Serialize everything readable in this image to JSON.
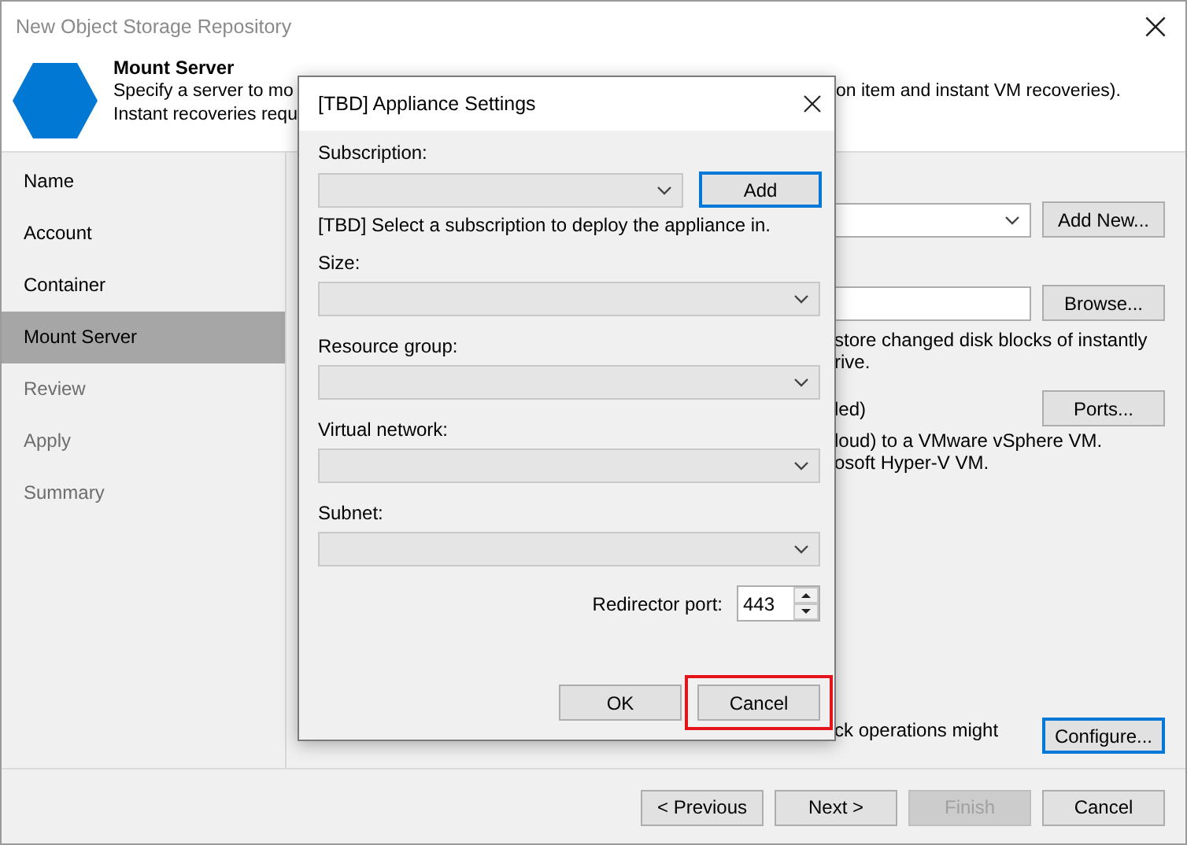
{
  "window": {
    "title": "New Object Storage Repository"
  },
  "header": {
    "title": "Mount Server",
    "line_1_start": "Specify a server to mo",
    "line_1_end": "on item and instant VM recoveries).",
    "line_2": "Instant recoveries requ"
  },
  "steps": [
    {
      "label": "Name",
      "selected": false,
      "disabled": false
    },
    {
      "label": "Account",
      "selected": false,
      "disabled": false
    },
    {
      "label": "Container",
      "selected": false,
      "disabled": false
    },
    {
      "label": "Mount Server",
      "selected": true,
      "disabled": false
    },
    {
      "label": "Review",
      "selected": false,
      "disabled": true
    },
    {
      "label": "Apply",
      "selected": false,
      "disabled": true
    },
    {
      "label": "Summary",
      "selected": false,
      "disabled": true
    }
  ],
  "page_rows": [
    {
      "kind": "combo",
      "button": "Add New..."
    },
    {
      "kind": "field",
      "button": "Browse..."
    },
    {
      "kind": "text",
      "lines": [
        "store changed disk blocks of instantly",
        "rive."
      ]
    },
    {
      "kind": "label_button",
      "text": "led)",
      "button": "Ports..."
    },
    {
      "kind": "text",
      "lines": [
        "loud) to a VMware vSphere VM.",
        "osoft Hyper-V VM."
      ]
    }
  ],
  "bottom_note": {
    "line_1": "ck operations might",
    "button": "Configure...",
    "focused": true
  },
  "footer_buttons": [
    {
      "label": "< Previous",
      "disabled": false
    },
    {
      "label": "Next >",
      "disabled": false
    },
    {
      "label": "Finish",
      "disabled": true
    },
    {
      "label": "Cancel",
      "disabled": false
    }
  ],
  "dialog": {
    "title": "[TBD] Appliance Settings",
    "fields": [
      {
        "label": "Subscription:",
        "disabled": true,
        "button": "Add",
        "button_focused": true,
        "hint": "[TBD] Select a subscription to deploy the appliance in."
      },
      {
        "label": "Size:",
        "disabled": true
      },
      {
        "label": "Resource group:",
        "disabled": true
      },
      {
        "label": "Virtual network:",
        "disabled": true
      },
      {
        "label": "Subnet:",
        "disabled": true
      }
    ],
    "port": {
      "label": "Redirector port:",
      "value": "443"
    },
    "buttons": [
      {
        "label": "OK",
        "highlighted": false
      },
      {
        "label": "Cancel",
        "highlighted": true
      }
    ]
  }
}
